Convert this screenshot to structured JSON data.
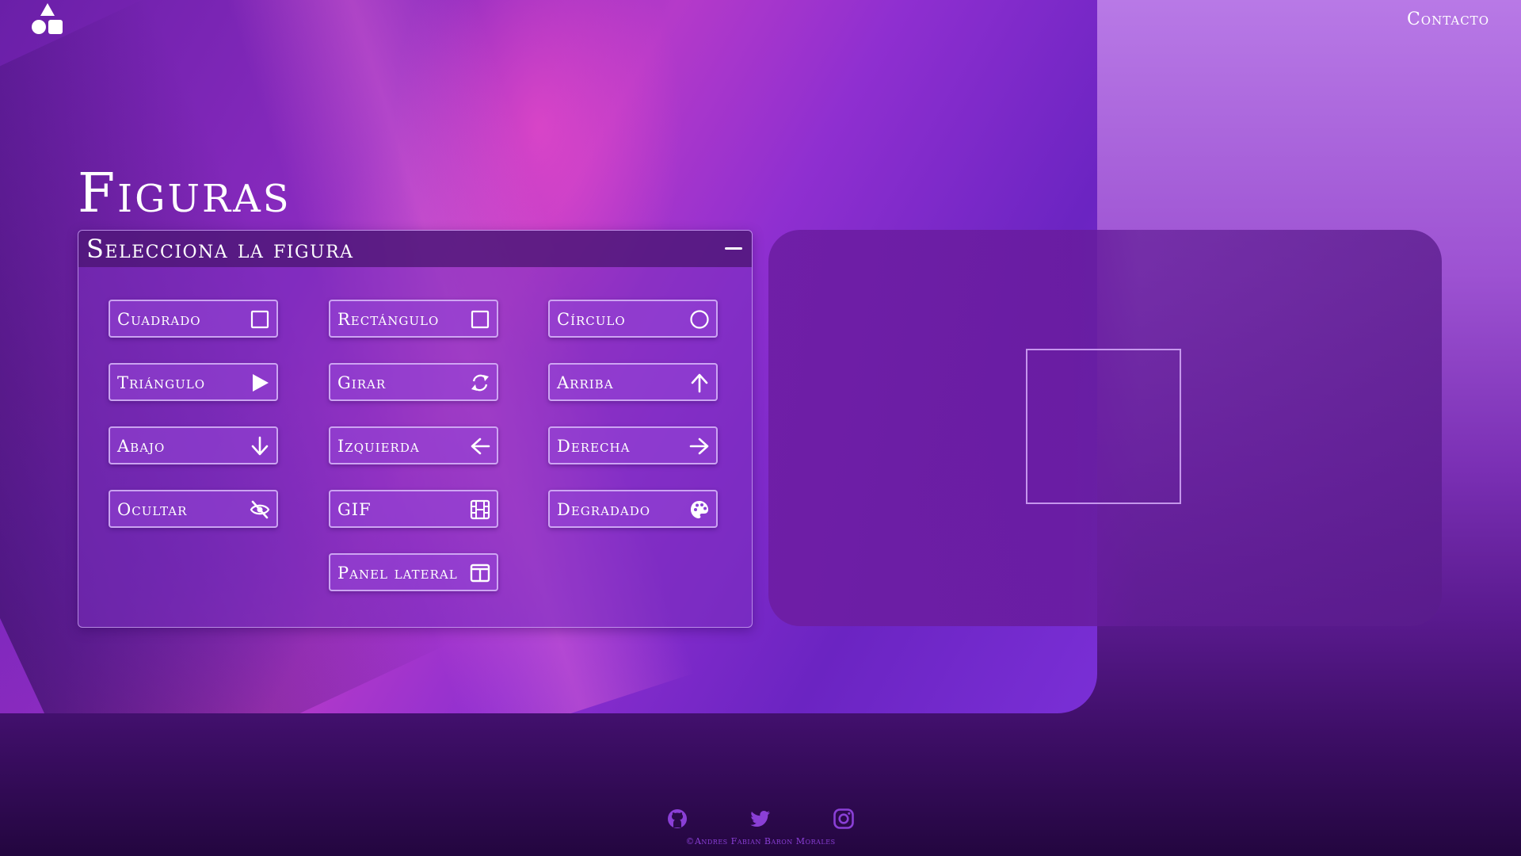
{
  "header": {
    "contact_label": "Contacto",
    "logo_icon": "shapes-logo-icon"
  },
  "main": {
    "title": "Figuras"
  },
  "panel": {
    "title": "Selecciona la figura",
    "minimize_icon": "minus-icon",
    "buttons": [
      {
        "label": "Cuadrado",
        "icon": "square-icon"
      },
      {
        "label": "Rectángulo",
        "icon": "square-icon"
      },
      {
        "label": "Círculo",
        "icon": "circle-icon"
      },
      {
        "label": "Triángulo",
        "icon": "play-icon"
      },
      {
        "label": "Girar",
        "icon": "rotate-icon"
      },
      {
        "label": "Arriba",
        "icon": "arrow-up-icon"
      },
      {
        "label": "Abajo",
        "icon": "arrow-down-icon"
      },
      {
        "label": "Izquierda",
        "icon": "arrow-left-icon"
      },
      {
        "label": "Derecha",
        "icon": "arrow-right-icon"
      },
      {
        "label": "Ocultar",
        "icon": "eye-slash-icon"
      },
      {
        "label": "GIF",
        "icon": "film-icon"
      },
      {
        "label": "Degradado",
        "icon": "palette-icon"
      },
      {
        "label": "Panel lateral",
        "icon": "sidebar-icon"
      }
    ]
  },
  "footer": {
    "icons": [
      "github-icon",
      "twitter-icon",
      "instagram-icon"
    ],
    "credit": "©Andres Fabian Baron Morales"
  },
  "colors": {
    "accent": "#8a3fd6",
    "hero": "#8a2bc0",
    "panel": "#7a2dbe",
    "footer": "#23063f"
  }
}
